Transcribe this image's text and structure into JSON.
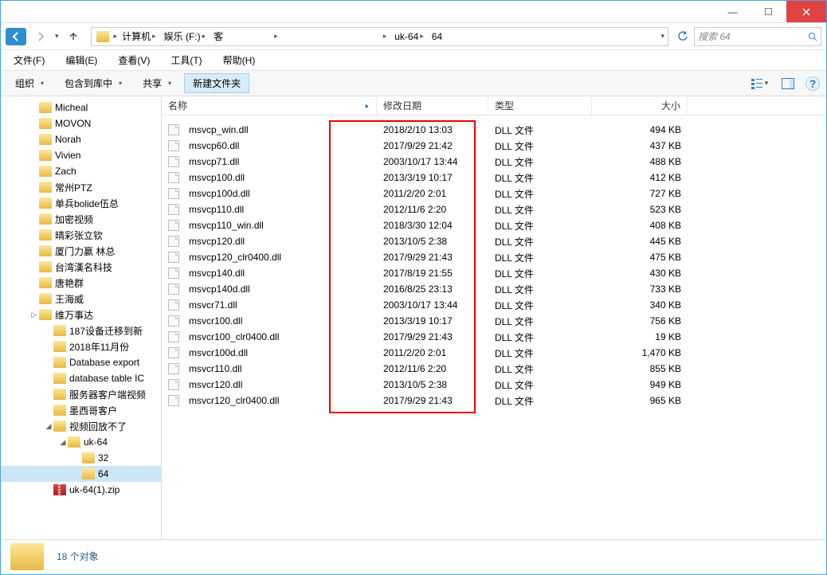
{
  "window": {
    "minimize": "—",
    "maximize": "▢",
    "close": "✕"
  },
  "nav": {
    "crumbs": [
      "计算机",
      "娱乐 (F:)",
      "客",
      "",
      "",
      "uk-64",
      "64"
    ],
    "refresh_label": "刷新",
    "search_placeholder": "搜索 64"
  },
  "menu": [
    "文件(F)",
    "编辑(E)",
    "查看(V)",
    "工具(T)",
    "帮助(H)"
  ],
  "toolbar": {
    "organize": "组织",
    "include": "包含到库中",
    "share": "共享",
    "newfolder": "新建文件夹"
  },
  "tree": [
    {
      "indent": 36,
      "name": "Micheal"
    },
    {
      "indent": 36,
      "name": "MOVON"
    },
    {
      "indent": 36,
      "name": "Norah"
    },
    {
      "indent": 36,
      "name": "Vivien"
    },
    {
      "indent": 36,
      "name": "Zach"
    },
    {
      "indent": 36,
      "name": "常州PTZ"
    },
    {
      "indent": 36,
      "name": "单兵bolide伍总"
    },
    {
      "indent": 36,
      "name": "加密视频"
    },
    {
      "indent": 36,
      "name": "晴彩张立钦"
    },
    {
      "indent": 36,
      "name": "厦门力赢 林总"
    },
    {
      "indent": 36,
      "name": "台湾漢名科技"
    },
    {
      "indent": 36,
      "name": "唐艳群"
    },
    {
      "indent": 36,
      "name": "王海威"
    },
    {
      "indent": 36,
      "name": "维万事达",
      "expander": "▷"
    },
    {
      "indent": 54,
      "name": "187设备迁移到新"
    },
    {
      "indent": 54,
      "name": "2018年11月份"
    },
    {
      "indent": 54,
      "name": "Database export"
    },
    {
      "indent": 54,
      "name": "database table IC"
    },
    {
      "indent": 54,
      "name": "服务器客户端视频"
    },
    {
      "indent": 54,
      "name": "墨西哥客户"
    },
    {
      "indent": 54,
      "name": "视频回放不了",
      "expander": "◢"
    },
    {
      "indent": 72,
      "name": "uk-64",
      "expander": "◢"
    },
    {
      "indent": 90,
      "name": "32"
    },
    {
      "indent": 90,
      "name": "64",
      "selected": true
    },
    {
      "indent": 54,
      "name": "uk-64(1).zip",
      "zip": true
    }
  ],
  "columns": {
    "name": "名称",
    "date": "修改日期",
    "type": "类型",
    "size": "大小"
  },
  "files": [
    {
      "name": "msvcp_win.dll",
      "date": "2018/2/10 13:03",
      "type": "DLL 文件",
      "size": "494 KB"
    },
    {
      "name": "msvcp60.dll",
      "date": "2017/9/29 21:42",
      "type": "DLL 文件",
      "size": "437 KB"
    },
    {
      "name": "msvcp71.dll",
      "date": "2003/10/17 13:44",
      "type": "DLL 文件",
      "size": "488 KB"
    },
    {
      "name": "msvcp100.dll",
      "date": "2013/3/19 10:17",
      "type": "DLL 文件",
      "size": "412 KB"
    },
    {
      "name": "msvcp100d.dll",
      "date": "2011/2/20 2:01",
      "type": "DLL 文件",
      "size": "727 KB"
    },
    {
      "name": "msvcp110.dll",
      "date": "2012/11/6 2:20",
      "type": "DLL 文件",
      "size": "523 KB"
    },
    {
      "name": "msvcp110_win.dll",
      "date": "2018/3/30 12:04",
      "type": "DLL 文件",
      "size": "408 KB"
    },
    {
      "name": "msvcp120.dll",
      "date": "2013/10/5 2:38",
      "type": "DLL 文件",
      "size": "445 KB"
    },
    {
      "name": "msvcp120_clr0400.dll",
      "date": "2017/9/29 21:43",
      "type": "DLL 文件",
      "size": "475 KB"
    },
    {
      "name": "msvcp140.dll",
      "date": "2017/8/19 21:55",
      "type": "DLL 文件",
      "size": "430 KB"
    },
    {
      "name": "msvcp140d.dll",
      "date": "2016/8/25 23:13",
      "type": "DLL 文件",
      "size": "733 KB"
    },
    {
      "name": "msvcr71.dll",
      "date": "2003/10/17 13:44",
      "type": "DLL 文件",
      "size": "340 KB"
    },
    {
      "name": "msvcr100.dll",
      "date": "2013/3/19 10:17",
      "type": "DLL 文件",
      "size": "756 KB"
    },
    {
      "name": "msvcr100_clr0400.dll",
      "date": "2017/9/29 21:43",
      "type": "DLL 文件",
      "size": "19 KB"
    },
    {
      "name": "msvcr100d.dll",
      "date": "2011/2/20 2:01",
      "type": "DLL 文件",
      "size": "1,470 KB"
    },
    {
      "name": "msvcr110.dll",
      "date": "2012/11/6 2:20",
      "type": "DLL 文件",
      "size": "855 KB"
    },
    {
      "name": "msvcr120.dll",
      "date": "2013/10/5 2:38",
      "type": "DLL 文件",
      "size": "949 KB"
    },
    {
      "name": "msvcr120_clr0400.dll",
      "date": "2017/9/29 21:43",
      "type": "DLL 文件",
      "size": "965 KB"
    }
  ],
  "status": {
    "count": "18 个对象"
  }
}
